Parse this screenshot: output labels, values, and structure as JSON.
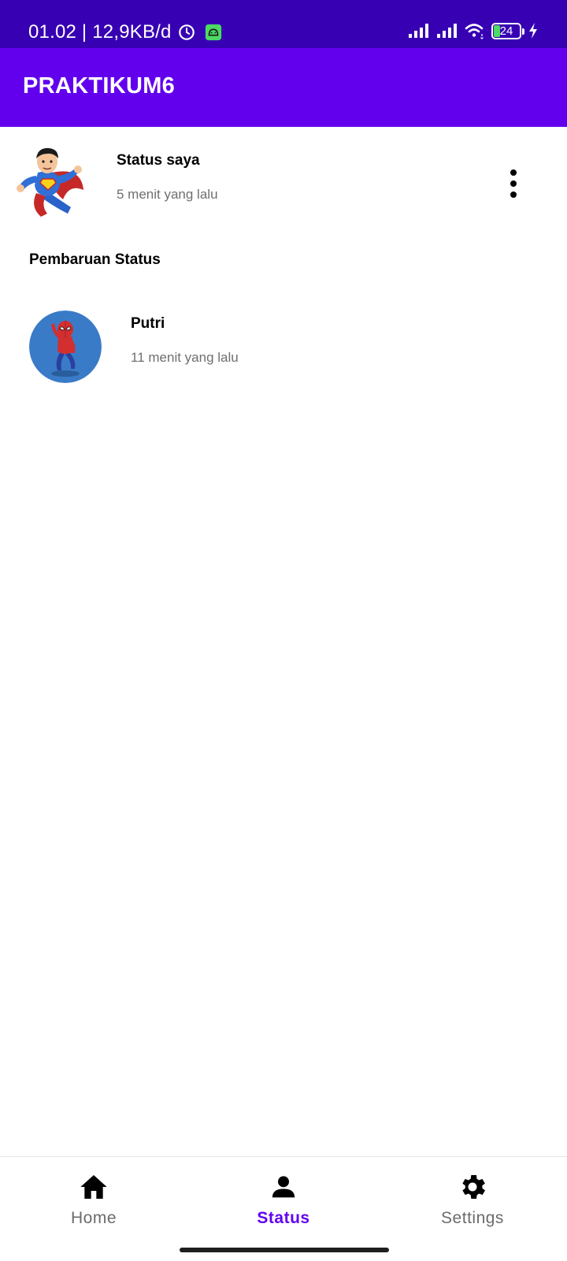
{
  "status_bar": {
    "time_speed": "01.02 | 12,9KB/d",
    "battery_level": "24",
    "icons": [
      "clock-icon",
      "android-app-icon",
      "signal-icon",
      "signal-icon",
      "wifi-icon",
      "battery-icon",
      "charging-icon"
    ]
  },
  "app_bar": {
    "title": "PRAKTIKUM6"
  },
  "my_status": {
    "name": "Status saya",
    "time": "5 menit yang lalu",
    "avatar": "superhero-avatar",
    "menu_icon": "more-vert-icon"
  },
  "updates": {
    "header": "Pembaruan Status",
    "items": [
      {
        "name": "Putri",
        "time": "11 menit yang lalu",
        "avatar": "spiderman-avatar"
      }
    ]
  },
  "bottom_nav": {
    "items": [
      {
        "label": "Home",
        "icon": "home-icon",
        "active": false
      },
      {
        "label": "Status",
        "icon": "person-icon",
        "active": true
      },
      {
        "label": "Settings",
        "icon": "gear-icon",
        "active": false
      }
    ]
  },
  "colors": {
    "status_bar": "#3700b3",
    "app_bar": "#6200ee",
    "accent": "#6200ee",
    "secondary_text": "#6f6f6f"
  }
}
